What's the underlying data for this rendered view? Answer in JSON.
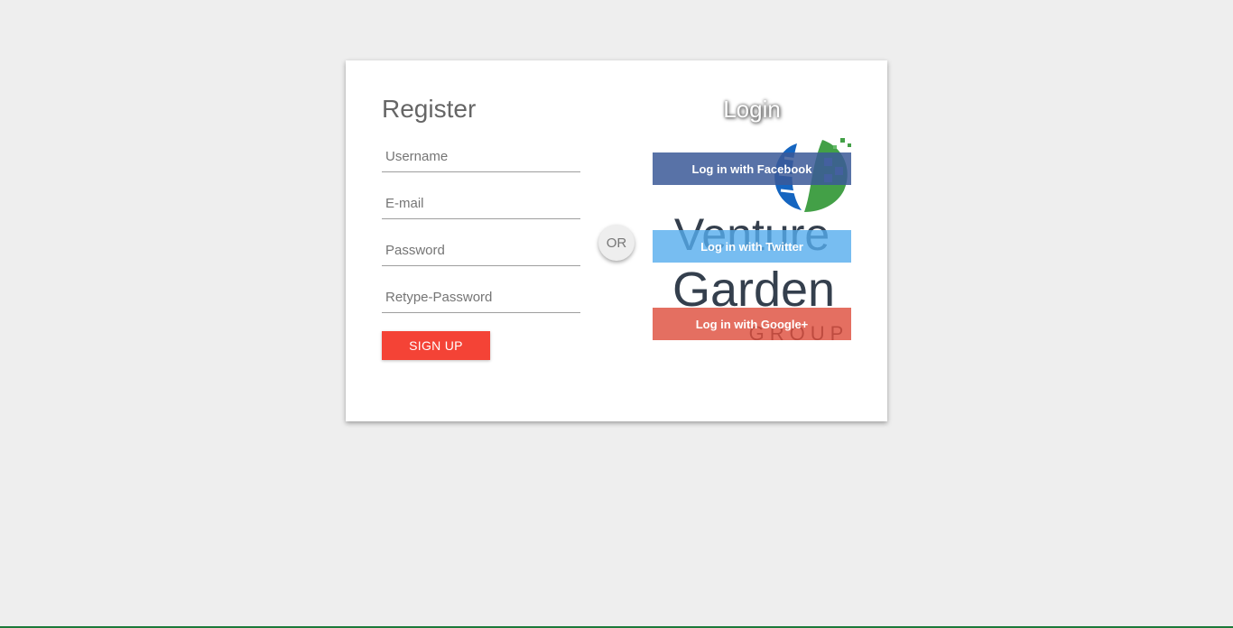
{
  "register": {
    "title": "Register",
    "username_placeholder": "Username",
    "email_placeholder": "E-mail",
    "password_placeholder": "Password",
    "retype_placeholder": "Retype-Password",
    "signup_label": "SIGN UP"
  },
  "divider": {
    "label": "OR"
  },
  "login": {
    "title": "Login",
    "facebook_label": "Log in with Facebook",
    "twitter_label": "Log in with Twitter",
    "google_label": "Log in with Google+"
  },
  "logo": {
    "line1": "Venture",
    "line2": "Garden",
    "line3": "GROUP"
  },
  "colors": {
    "signup": "#f44336",
    "facebook": "#3b5998",
    "twitter": "#55acee",
    "google": "#dd4b39",
    "logo_text": "#1e2a3a",
    "logo_blue": "#1565c0",
    "logo_green": "#43a047"
  }
}
